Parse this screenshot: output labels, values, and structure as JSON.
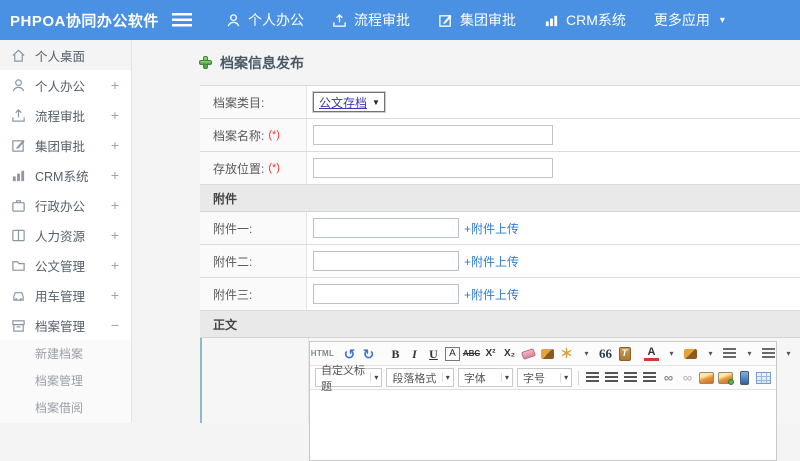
{
  "topbar": {
    "logo": "PHPOA协同办公软件",
    "nav": [
      {
        "label": "个人办公",
        "icon": "user-icon"
      },
      {
        "label": "流程审批",
        "icon": "upload-icon"
      },
      {
        "label": "集团审批",
        "icon": "edit-icon"
      },
      {
        "label": "CRM系统",
        "icon": "chart-icon"
      },
      {
        "label": "更多应用",
        "icon": "caret-down-icon"
      }
    ],
    "more_caret": "▾"
  },
  "sidebar": {
    "items": [
      {
        "label": "个人桌面",
        "icon": "home-icon",
        "expand": ""
      },
      {
        "label": "个人办公",
        "icon": "user-icon",
        "expand": "+"
      },
      {
        "label": "流程审批",
        "icon": "upload-icon",
        "expand": "+"
      },
      {
        "label": "集团审批",
        "icon": "edit-icon",
        "expand": "+"
      },
      {
        "label": "CRM系统",
        "icon": "chart-icon",
        "expand": "+"
      },
      {
        "label": "行政办公",
        "icon": "briefcase-icon",
        "expand": "+"
      },
      {
        "label": "人力资源",
        "icon": "book-icon",
        "expand": "+"
      },
      {
        "label": "公文管理",
        "icon": "folder-icon",
        "expand": "+"
      },
      {
        "label": "用车管理",
        "icon": "car-icon",
        "expand": "+"
      },
      {
        "label": "档案管理",
        "icon": "archive-icon",
        "expand": "−"
      }
    ],
    "subitems": [
      {
        "label": "新建档案"
      },
      {
        "label": "档案管理"
      },
      {
        "label": "档案借阅"
      }
    ]
  },
  "main": {
    "title": "档案信息发布",
    "form": {
      "category_label": "档案类目:",
      "category_value": "公文存档",
      "select_caret": "▼",
      "name_label": "档案名称:",
      "location_label": "存放位置:",
      "required_mark": "(*)",
      "attachment_header": "附件",
      "attachments": [
        {
          "label": "附件一:"
        },
        {
          "label": "附件二:"
        },
        {
          "label": "附件三:"
        }
      ],
      "upload_link": "+附件上传",
      "body_header": "正文"
    }
  },
  "editor": {
    "glyphs": {
      "html": "HTML",
      "undo": "↺",
      "redo": "↻",
      "bold": "B",
      "italic": "I",
      "underline": "U",
      "font_box": "A",
      "strike": "ABC",
      "superscript": "X²",
      "subscript": "X₂",
      "wand": "＊",
      "quote": "66",
      "paste_text": "T",
      "forecolor": "A",
      "link": "∞",
      "unlink": "∞",
      "caret": "▾"
    },
    "dropdowns": [
      {
        "label": "自定义标题"
      },
      {
        "label": "段落格式"
      },
      {
        "label": "字体"
      },
      {
        "label": "字号"
      }
    ]
  },
  "colors": {
    "topbar_blue": "#4a91e3",
    "link_blue": "#2f7cd0",
    "required_red": "#e03a3a",
    "section_gray": "#e9e9e9",
    "select_text_blue": "#3a3ab0",
    "plus_green": "#49a23b"
  }
}
